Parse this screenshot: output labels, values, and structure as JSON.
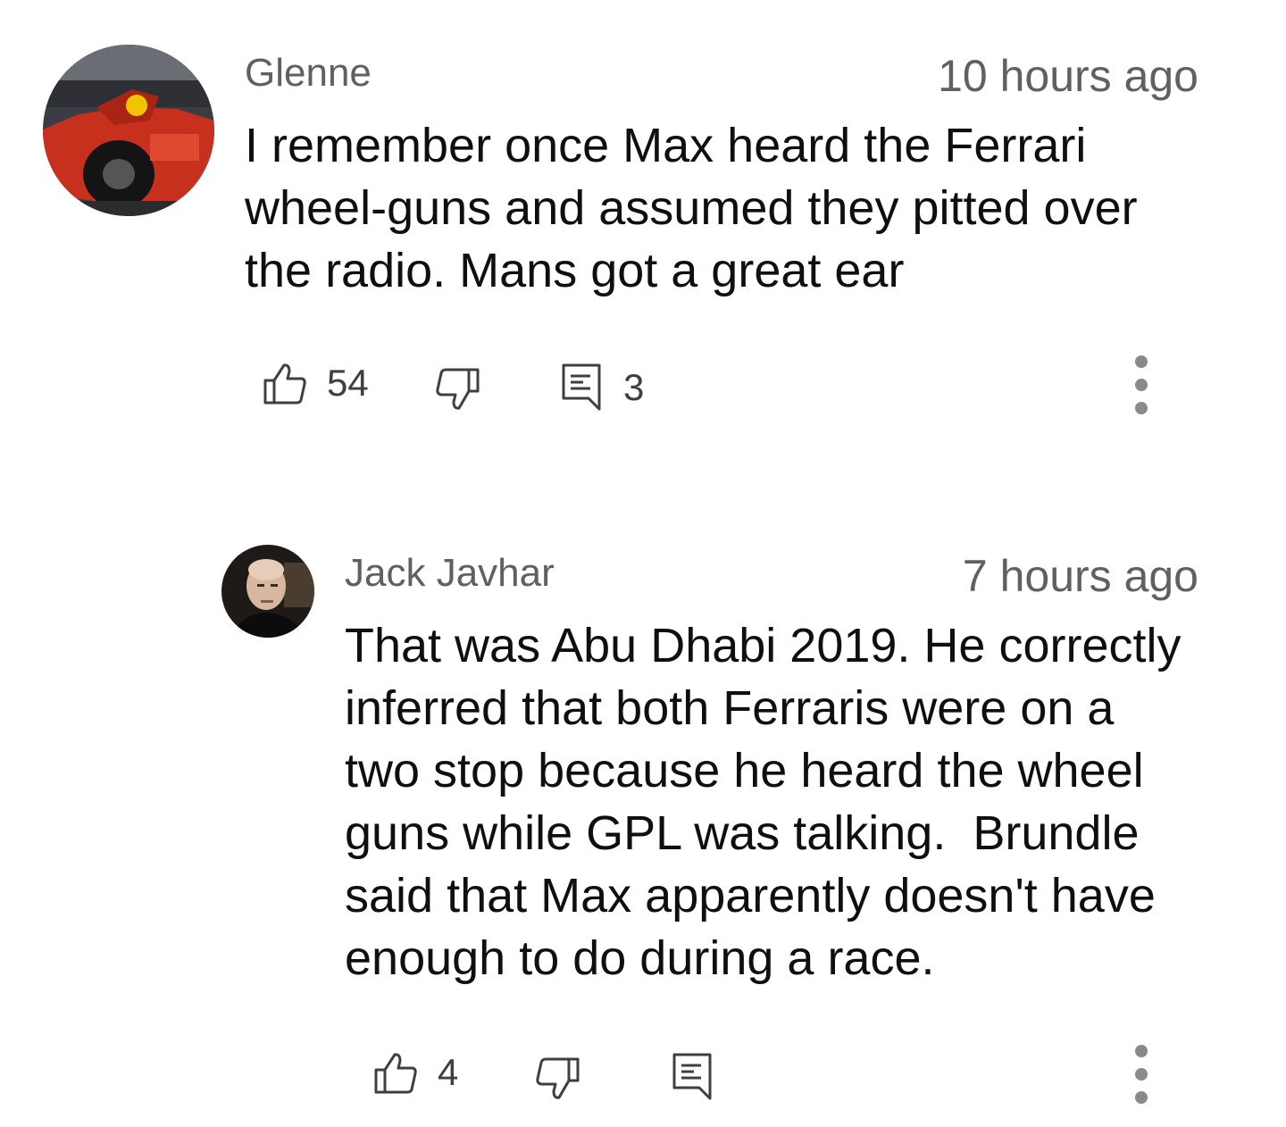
{
  "comments": [
    {
      "author": "Glenne",
      "time": "10 hours ago",
      "text": "I remember once Max heard the Ferrari\nwheel-guns and assumed they pitted over\nthe radio. Mans got a great ear",
      "likes": "54",
      "replies": "3",
      "avatar_icon": "ferrari-car-avatar"
    },
    {
      "author": "Jack Javhar",
      "time": "7 hours ago",
      "text": "That was Abu Dhabi 2019. He correctly\ninferred that both Ferraris were on a\ntwo stop because he heard the wheel\nguns while GPL was talking.  Brundle\nsaid that Max apparently doesn't have\nenough to do during a race.",
      "likes": "4",
      "avatar_icon": "person-avatar"
    }
  ],
  "colors": {
    "secondary_text": "#606060",
    "primary_text": "#0f0f0f",
    "icon": "#3f3f3f"
  }
}
